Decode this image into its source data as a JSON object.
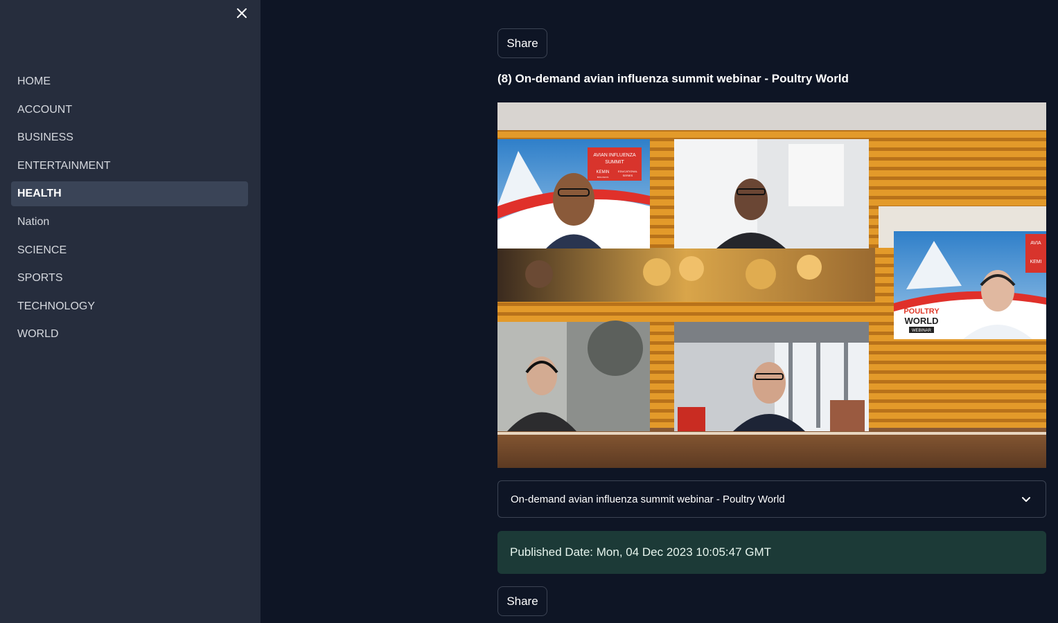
{
  "sidebar": {
    "close_icon": "close-icon",
    "items": [
      {
        "label": "HOME",
        "active": false
      },
      {
        "label": "ACCOUNT",
        "active": false
      },
      {
        "label": "BUSINESS",
        "active": false
      },
      {
        "label": "ENTERTAINMENT",
        "active": false
      },
      {
        "label": "HEALTH",
        "active": true
      },
      {
        "label": "Nation",
        "active": false
      },
      {
        "label": "SCIENCE",
        "active": false
      },
      {
        "label": "SPORTS",
        "active": false
      },
      {
        "label": "TECHNOLOGY",
        "active": false
      },
      {
        "label": "WORLD",
        "active": false
      }
    ]
  },
  "main": {
    "share_label": "Share",
    "article_title": "(8) On-demand avian influenza summit webinar - Poultry World",
    "video": {
      "thumbnail_texts": {
        "summit_line1": "AVIAN INFLUENZA",
        "summit_line2": "SUMMIT",
        "kemin": "KEMIN",
        "kemin_sub": "BIOLOGICS",
        "edu_line1": "EDUCATIONAL",
        "edu_line2": "SERIES",
        "poultry": "POULTRY",
        "world": "WORLD",
        "webinar": "WEBINAR",
        "avia_partial": "AVIA",
        "kemin_partial": "KEMI"
      }
    },
    "expander_label": "On-demand avian influenza summit webinar - Poultry World",
    "published": "Published Date: Mon, 04 Dec 2023 10:05:47 GMT"
  },
  "colors": {
    "sidebar_bg": "#262d3d",
    "main_bg": "#0e1525",
    "active_item_bg": "#3a4457",
    "published_bg": "#1c3a37"
  }
}
